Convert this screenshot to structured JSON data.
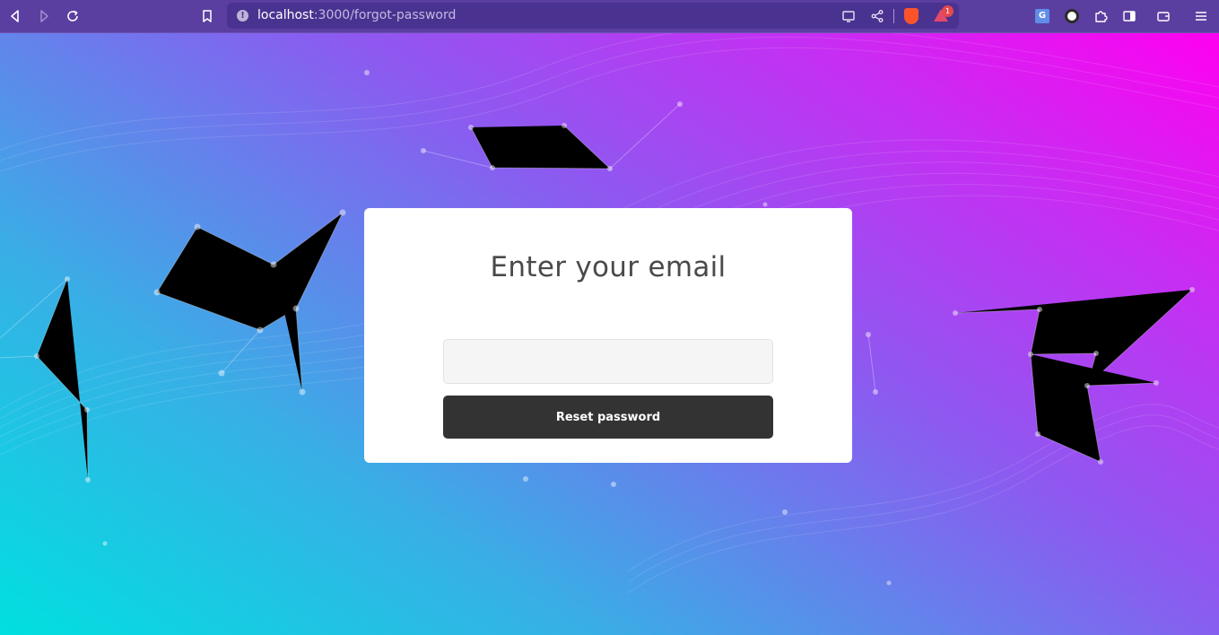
{
  "browser": {
    "url_host": "localhost",
    "url_path": ":3000/forgot-password",
    "rewards_badge": "1",
    "translate_ext_label": "G",
    "icons": [
      "back-icon",
      "forward-icon",
      "reload-icon",
      "bookmark-icon",
      "site-info-icon",
      "cast-icon",
      "share-icon",
      "brave-shields-icon",
      "brave-rewards-icon",
      "translate-extension-icon",
      "extension-icon",
      "puzzle-icon",
      "sidebar-icon",
      "wallet-icon",
      "menu-icon"
    ]
  },
  "form": {
    "title": "Enter your email",
    "email_value": "",
    "button_label": "Reset password"
  },
  "colors": {
    "toolbar": "#5b3fa0",
    "button_bg": "#333333",
    "card_bg": "#ffffff",
    "gradient_start": "#00e0e0",
    "gradient_end": "#ff00f0"
  }
}
